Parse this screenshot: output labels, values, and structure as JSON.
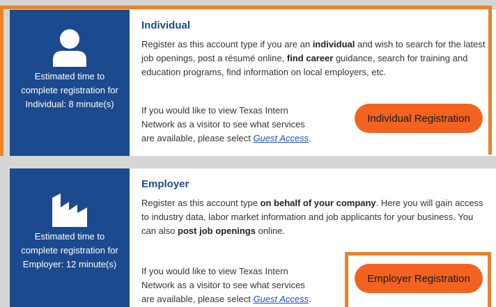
{
  "individual": {
    "icon": "person-icon",
    "side_text": "Estimated time to complete registration for Individual: 8 minute(s)",
    "title": "Individual",
    "desc_parts": [
      "Register as this account type if you are an ",
      "individual",
      " and wish to search for the latest job openings, post a résumé online, ",
      "find career",
      " guidance, search for training and education programs, find information on local employers, etc."
    ],
    "visitor_text": "If you would like to view Texas Intern Network as a visitor to see what services are available, please select ",
    "visitor_link": "Guest Access",
    "visitor_end": ".",
    "button_label": "Individual Registration"
  },
  "employer": {
    "icon": "factory-icon",
    "side_text": "Estimated time to complete registration for Employer: 12 minute(s)",
    "title": "Employer",
    "desc_parts": [
      "Register as this account type ",
      "on behalf of your company",
      ". Here you will gain access to industry data, labor market information and job applicants for your business. You can also ",
      "post job openings",
      " online."
    ],
    "visitor_text": "If you would like to view Texas Intern Network as a visitor to see what services are available, please select ",
    "visitor_link": "Guest Access",
    "visitor_end": ".",
    "button_label": "Employer Registration"
  },
  "colors": {
    "sidebar": "#1c4a8f",
    "button": "#f26322",
    "highlight_frame": "#e8832a",
    "link": "#1d4fc4"
  }
}
